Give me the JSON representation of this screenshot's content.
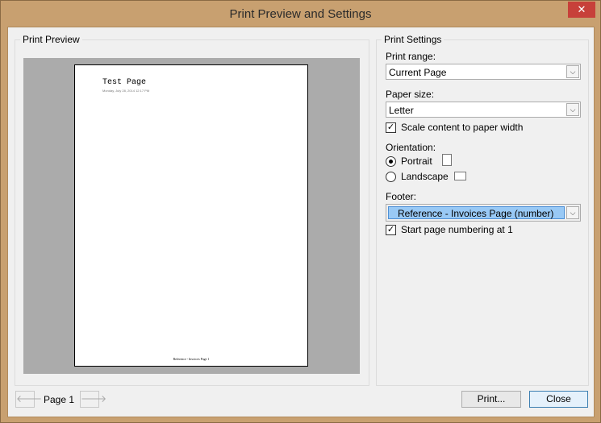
{
  "window": {
    "title": "Print Preview and Settings",
    "close_glyph": "✕"
  },
  "preview": {
    "legend": "Print Preview",
    "page": {
      "title": "Test Page",
      "date_line": "Monday, July 28, 2014          12:17 PM",
      "footer": "Reference - Invoices Page 1"
    }
  },
  "settings": {
    "legend": "Print Settings",
    "print_range": {
      "label": "Print range:",
      "value": "Current Page"
    },
    "paper_size": {
      "label": "Paper size:",
      "value": "Letter"
    },
    "scale_checkbox": {
      "label": "Scale content to paper width",
      "checked": true
    },
    "orientation": {
      "label": "Orientation:",
      "portrait": "Portrait",
      "landscape": "Landscape",
      "selected": "portrait"
    },
    "footer": {
      "label": "Footer:",
      "value": "Reference - Invoices Page (number)"
    },
    "page_numbering_checkbox": {
      "label": "Start page numbering at 1",
      "checked": true
    }
  },
  "bottom": {
    "prev_icon": "arrow-left-icon",
    "page_label": "Page 1",
    "next_icon": "arrow-right-icon",
    "print_button": "Print...",
    "close_button": "Close"
  },
  "colors": {
    "selection_fill": "#99c9f5",
    "preview_bg": "#ababab",
    "frame": "#c8a070"
  }
}
